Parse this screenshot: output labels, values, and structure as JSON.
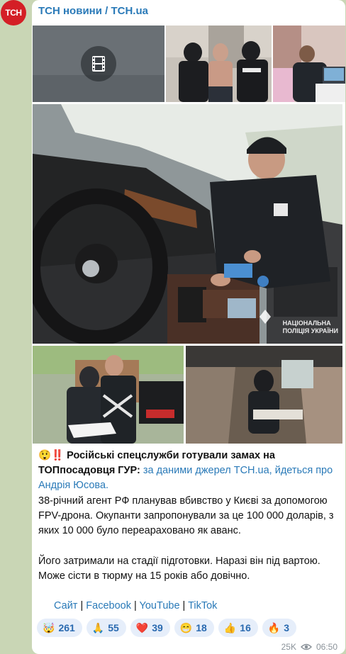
{
  "channel": {
    "name": "ТСН новини / TCH.ua",
    "avatar_text": "ТСН",
    "brand_color": "#d41f26"
  },
  "media": {
    "video_icon": "film-icon",
    "watermark_top": "НАЦІОНАЛЬНА ПОЛІЦІЯ УКРАЇНИ",
    "watermark_main_line1": "НАЦІОНАЛЬНА",
    "watermark_main_line2": "ПОЛІЦІЯ УКРАЇНИ",
    "badge_text": "ПОЛІЦІЯ"
  },
  "post": {
    "headline_emoji": "😲‼️",
    "headline": "Російські спецслужби готували замах на ТОПпосадовця ГУР:",
    "headline_link": "за даними джерел TCH.ua, йдеться про Андрія Юсова.",
    "paragraph1": "38-річний агент РФ планував вбивство у Києві за допомогою FPV-дрона. Окупанти запропонували за це 100 000 доларів, з яких 10 000 було переараховано як аванс.",
    "paragraph2": "Його затримали на стадії підготовки. Наразі він під вартою. Може сісти в тюрму на 15 років або довічно.",
    "links": [
      "Сайт",
      "Facebook",
      "YouTube",
      "TikTok"
    ],
    "separator": " | "
  },
  "reactions": [
    {
      "emoji": "🤯",
      "count": "261"
    },
    {
      "emoji": "🙏",
      "count": "55"
    },
    {
      "emoji": "❤️",
      "count": "39"
    },
    {
      "emoji": "😁",
      "count": "18"
    },
    {
      "emoji": "👍",
      "count": "16"
    },
    {
      "emoji": "🔥",
      "count": "3"
    }
  ],
  "meta": {
    "views": "25K",
    "time": "06:50",
    "views_icon": "eye-icon"
  },
  "colors": {
    "background": "#c9d6b5",
    "link": "#2a7ab8",
    "reaction_bg": "#e6eefa"
  }
}
